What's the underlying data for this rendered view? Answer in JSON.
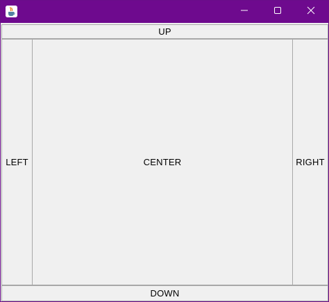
{
  "window": {
    "title_bar_color": "#6e0a8e",
    "icon": "java-coffee-cup-icon",
    "controls": {
      "minimize_icon": "minimize-icon",
      "maximize_icon": "maximize-icon",
      "close_icon": "close-icon"
    }
  },
  "buttons": {
    "up": "UP",
    "left": "LEFT",
    "center": "CENTER",
    "right": "RIGHT",
    "down": "DOWN"
  }
}
